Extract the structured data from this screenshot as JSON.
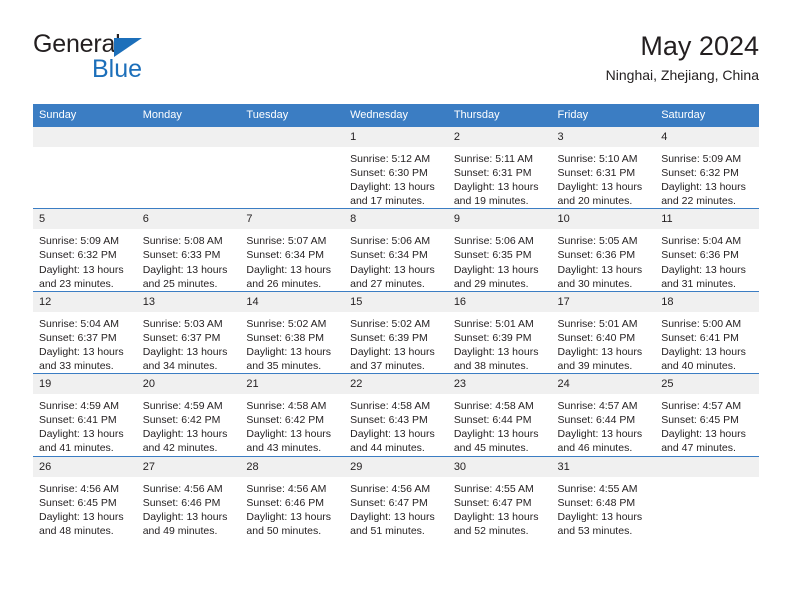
{
  "brand": {
    "name_part1": "General",
    "name_part2": "Blue",
    "accent_color": "#1c6fba"
  },
  "header": {
    "title": "May 2024",
    "subtitle": "Ninghai, Zhejiang, China"
  },
  "calendar": {
    "header_color": "#3b7dc3",
    "weekday_headers": [
      "Sunday",
      "Monday",
      "Tuesday",
      "Wednesday",
      "Thursday",
      "Friday",
      "Saturday"
    ],
    "weeks": [
      [
        {
          "day": "",
          "lines": []
        },
        {
          "day": "",
          "lines": []
        },
        {
          "day": "",
          "lines": []
        },
        {
          "day": "1",
          "lines": [
            "Sunrise: 5:12 AM",
            "Sunset: 6:30 PM",
            "Daylight: 13 hours",
            "and 17 minutes."
          ]
        },
        {
          "day": "2",
          "lines": [
            "Sunrise: 5:11 AM",
            "Sunset: 6:31 PM",
            "Daylight: 13 hours",
            "and 19 minutes."
          ]
        },
        {
          "day": "3",
          "lines": [
            "Sunrise: 5:10 AM",
            "Sunset: 6:31 PM",
            "Daylight: 13 hours",
            "and 20 minutes."
          ]
        },
        {
          "day": "4",
          "lines": [
            "Sunrise: 5:09 AM",
            "Sunset: 6:32 PM",
            "Daylight: 13 hours",
            "and 22 minutes."
          ]
        }
      ],
      [
        {
          "day": "5",
          "lines": [
            "Sunrise: 5:09 AM",
            "Sunset: 6:32 PM",
            "Daylight: 13 hours",
            "and 23 minutes."
          ]
        },
        {
          "day": "6",
          "lines": [
            "Sunrise: 5:08 AM",
            "Sunset: 6:33 PM",
            "Daylight: 13 hours",
            "and 25 minutes."
          ]
        },
        {
          "day": "7",
          "lines": [
            "Sunrise: 5:07 AM",
            "Sunset: 6:34 PM",
            "Daylight: 13 hours",
            "and 26 minutes."
          ]
        },
        {
          "day": "8",
          "lines": [
            "Sunrise: 5:06 AM",
            "Sunset: 6:34 PM",
            "Daylight: 13 hours",
            "and 27 minutes."
          ]
        },
        {
          "day": "9",
          "lines": [
            "Sunrise: 5:06 AM",
            "Sunset: 6:35 PM",
            "Daylight: 13 hours",
            "and 29 minutes."
          ]
        },
        {
          "day": "10",
          "lines": [
            "Sunrise: 5:05 AM",
            "Sunset: 6:36 PM",
            "Daylight: 13 hours",
            "and 30 minutes."
          ]
        },
        {
          "day": "11",
          "lines": [
            "Sunrise: 5:04 AM",
            "Sunset: 6:36 PM",
            "Daylight: 13 hours",
            "and 31 minutes."
          ]
        }
      ],
      [
        {
          "day": "12",
          "lines": [
            "Sunrise: 5:04 AM",
            "Sunset: 6:37 PM",
            "Daylight: 13 hours",
            "and 33 minutes."
          ]
        },
        {
          "day": "13",
          "lines": [
            "Sunrise: 5:03 AM",
            "Sunset: 6:37 PM",
            "Daylight: 13 hours",
            "and 34 minutes."
          ]
        },
        {
          "day": "14",
          "lines": [
            "Sunrise: 5:02 AM",
            "Sunset: 6:38 PM",
            "Daylight: 13 hours",
            "and 35 minutes."
          ]
        },
        {
          "day": "15",
          "lines": [
            "Sunrise: 5:02 AM",
            "Sunset: 6:39 PM",
            "Daylight: 13 hours",
            "and 37 minutes."
          ]
        },
        {
          "day": "16",
          "lines": [
            "Sunrise: 5:01 AM",
            "Sunset: 6:39 PM",
            "Daylight: 13 hours",
            "and 38 minutes."
          ]
        },
        {
          "day": "17",
          "lines": [
            "Sunrise: 5:01 AM",
            "Sunset: 6:40 PM",
            "Daylight: 13 hours",
            "and 39 minutes."
          ]
        },
        {
          "day": "18",
          "lines": [
            "Sunrise: 5:00 AM",
            "Sunset: 6:41 PM",
            "Daylight: 13 hours",
            "and 40 minutes."
          ]
        }
      ],
      [
        {
          "day": "19",
          "lines": [
            "Sunrise: 4:59 AM",
            "Sunset: 6:41 PM",
            "Daylight: 13 hours",
            "and 41 minutes."
          ]
        },
        {
          "day": "20",
          "lines": [
            "Sunrise: 4:59 AM",
            "Sunset: 6:42 PM",
            "Daylight: 13 hours",
            "and 42 minutes."
          ]
        },
        {
          "day": "21",
          "lines": [
            "Sunrise: 4:58 AM",
            "Sunset: 6:42 PM",
            "Daylight: 13 hours",
            "and 43 minutes."
          ]
        },
        {
          "day": "22",
          "lines": [
            "Sunrise: 4:58 AM",
            "Sunset: 6:43 PM",
            "Daylight: 13 hours",
            "and 44 minutes."
          ]
        },
        {
          "day": "23",
          "lines": [
            "Sunrise: 4:58 AM",
            "Sunset: 6:44 PM",
            "Daylight: 13 hours",
            "and 45 minutes."
          ]
        },
        {
          "day": "24",
          "lines": [
            "Sunrise: 4:57 AM",
            "Sunset: 6:44 PM",
            "Daylight: 13 hours",
            "and 46 minutes."
          ]
        },
        {
          "day": "25",
          "lines": [
            "Sunrise: 4:57 AM",
            "Sunset: 6:45 PM",
            "Daylight: 13 hours",
            "and 47 minutes."
          ]
        }
      ],
      [
        {
          "day": "26",
          "lines": [
            "Sunrise: 4:56 AM",
            "Sunset: 6:45 PM",
            "Daylight: 13 hours",
            "and 48 minutes."
          ]
        },
        {
          "day": "27",
          "lines": [
            "Sunrise: 4:56 AM",
            "Sunset: 6:46 PM",
            "Daylight: 13 hours",
            "and 49 minutes."
          ]
        },
        {
          "day": "28",
          "lines": [
            "Sunrise: 4:56 AM",
            "Sunset: 6:46 PM",
            "Daylight: 13 hours",
            "and 50 minutes."
          ]
        },
        {
          "day": "29",
          "lines": [
            "Sunrise: 4:56 AM",
            "Sunset: 6:47 PM",
            "Daylight: 13 hours",
            "and 51 minutes."
          ]
        },
        {
          "day": "30",
          "lines": [
            "Sunrise: 4:55 AM",
            "Sunset: 6:47 PM",
            "Daylight: 13 hours",
            "and 52 minutes."
          ]
        },
        {
          "day": "31",
          "lines": [
            "Sunrise: 4:55 AM",
            "Sunset: 6:48 PM",
            "Daylight: 13 hours",
            "and 53 minutes."
          ]
        },
        {
          "day": "",
          "lines": []
        }
      ]
    ]
  }
}
